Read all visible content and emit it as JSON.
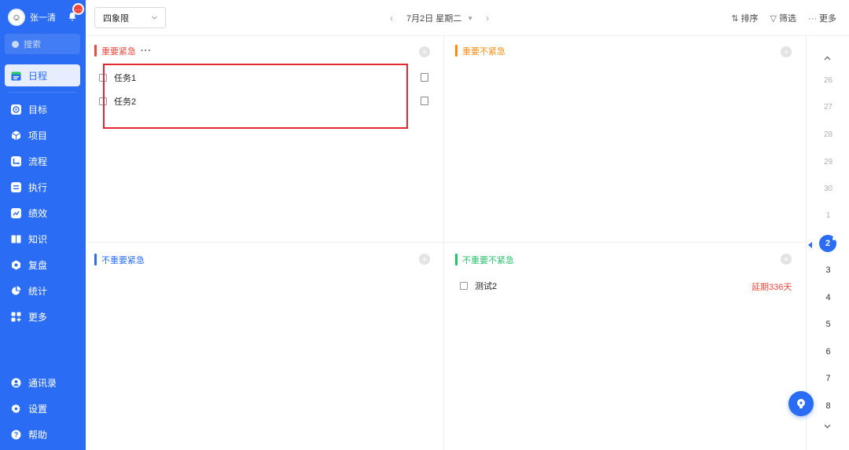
{
  "user": {
    "name": "张一清",
    "badge": "…"
  },
  "search": {
    "placeholder": "搜索"
  },
  "nav": {
    "schedule": "日程",
    "goal": "目标",
    "project": "项目",
    "process": "流程",
    "execute": "执行",
    "performance": "绩效",
    "knowledge": "知识",
    "review": "复盘",
    "stats": "统计",
    "more": "更多",
    "contacts": "通讯录",
    "settings": "设置",
    "help": "帮助"
  },
  "toolbar": {
    "view_mode": "四象限",
    "date": "7月2日 星期二",
    "prev": "‹",
    "next": "›",
    "sort": "排序",
    "filter": "筛选",
    "more": "更多"
  },
  "quadrants": {
    "q1": {
      "title": "重要紧急",
      "color": "#f0483e",
      "tasks": [
        "任务1",
        "任务2"
      ]
    },
    "q2": {
      "title": "重要不紧急",
      "color": "#fa8c16",
      "tasks": []
    },
    "q3": {
      "title": "不重要紧急",
      "color": "#2a6cf4",
      "tasks": []
    },
    "q4": {
      "title": "不重要不紧急",
      "color": "#27c26c",
      "tasks": [
        "测试2"
      ],
      "overdue": "延期336天"
    }
  },
  "date_strip": {
    "past": [
      "26",
      "27",
      "28",
      "29",
      "30",
      "1"
    ],
    "today": "2",
    "future": [
      "3",
      "4",
      "5",
      "6",
      "7",
      "8"
    ]
  },
  "colors": {
    "accent": "#2a6cf4",
    "sidebar_bg": "#2a6cf4",
    "overdue": "#f0483e"
  }
}
